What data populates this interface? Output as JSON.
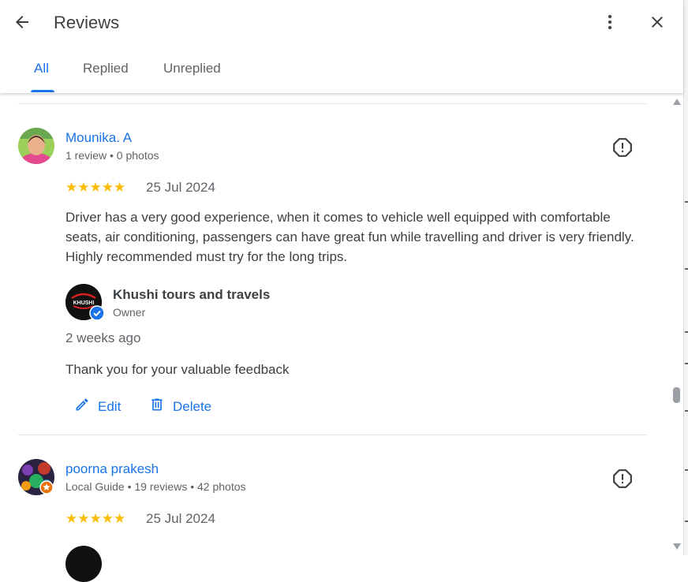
{
  "header": {
    "title": "Reviews",
    "tabs": [
      "All",
      "Replied",
      "Unreplied"
    ],
    "active_tab": "All"
  },
  "reviews": [
    {
      "name": "Mounika. A",
      "meta": "1 review • 0 photos",
      "rating": 5,
      "stars": "★★★★★",
      "date": "25 Jul 2024",
      "text": "Driver has a very good experience, when it comes to vehicle well equipped with comfortable seats, air conditioning, passengers can have great fun while travelling and driver is very friendly. Highly recommended must try for the long trips.",
      "reply": {
        "owner_name": "Khushi tours and travels",
        "owner_role": "Owner",
        "owner_logo_text": "KHUSHI",
        "time": "2 weeks ago",
        "text": "Thank you for your valuable feedback",
        "edit_label": "Edit",
        "delete_label": "Delete"
      }
    },
    {
      "name": "poorna prakesh",
      "meta": "Local Guide • 19 reviews • 42 photos",
      "rating": 5,
      "stars": "★★★★★",
      "date": "25 Jul 2024"
    }
  ],
  "colors": {
    "accent": "#1a73e8",
    "star": "#fbbc04",
    "verified": "#1a73e8",
    "local_guide": "#e8710a"
  }
}
